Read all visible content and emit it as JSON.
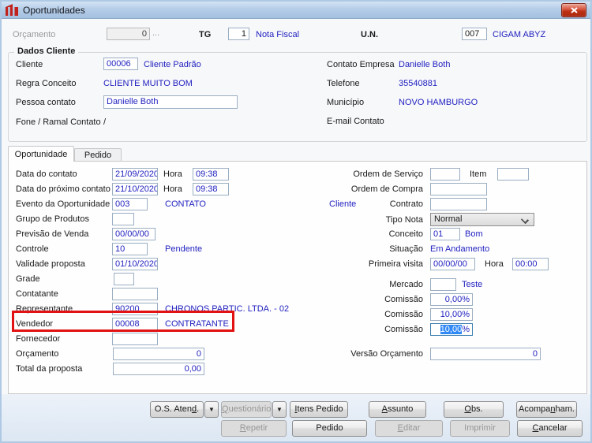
{
  "window": {
    "title": "Oportunidades"
  },
  "icons": {
    "dropdown_arrow": "▼"
  },
  "colors": {
    "value_text": "#2222C0",
    "highlight_box": "#E31212",
    "selection_bg": "#3189F5"
  },
  "header": {
    "orcamento_label": "Orçamento",
    "orcamento_value": "0",
    "ellipsis": "...",
    "tg_label": "TG",
    "tg_value": "1",
    "tg_desc": "Nota Fiscal",
    "un_label": "U.N.",
    "un_value": "007",
    "un_desc": "CIGAM ABYZ"
  },
  "dados_cliente": {
    "title": "Dados Cliente",
    "cliente_label": "Cliente",
    "cliente_value": "00006",
    "cliente_desc": "Cliente Padrão",
    "regra_label": "Regra Conceito",
    "regra_value": "CLIENTE MUITO BOM",
    "pessoa_label": "Pessoa contato",
    "pessoa_value": "Danielle Both",
    "fone_label": "Fone / Ramal Contato",
    "fone_value": "/",
    "contato_empresa_label": "Contato Empresa",
    "contato_empresa_value": "Danielle Both",
    "telefone_label": "Telefone",
    "telefone_value": "35540881",
    "municipio_label": "Município",
    "municipio_value": "NOVO HAMBURGO",
    "email_label": "E-mail Contato",
    "email_value": ""
  },
  "tabs": {
    "oportunidade": "Oportunidade",
    "pedido": "Pedido"
  },
  "left": {
    "rows": [
      {
        "label": "Data do contato",
        "value": "21/09/2020",
        "hora_label": "Hora",
        "hora_value": "09:38"
      },
      {
        "label": "Data do próximo contato",
        "value": "21/10/2020",
        "hora_label": "Hora",
        "hora_value": "09:38"
      },
      {
        "label": "Evento da Oportunidade",
        "value": "003",
        "desc": "CONTATO",
        "extra": "Cliente"
      },
      {
        "label": "Grupo de Produtos",
        "value": ""
      },
      {
        "label": "Previsão de Venda",
        "value": "00/00/00"
      },
      {
        "label": "Controle",
        "value": "10",
        "desc": "Pendente"
      },
      {
        "label": "Validade proposta",
        "value": "01/10/2020"
      },
      {
        "label": "Grade",
        "value": ""
      },
      {
        "label": "Contatante",
        "value": ""
      },
      {
        "label": "Representante",
        "value": "90200",
        "desc": "CHRONOS PARTIC. LTDA. - 02"
      },
      {
        "label": "Vendedor",
        "value": "00008",
        "desc": "CONTRATANTE"
      },
      {
        "label": "Fornecedor",
        "value": ""
      },
      {
        "label": "Orçamento",
        "value": "0"
      },
      {
        "label": "Total da proposta",
        "value": "0,00"
      }
    ]
  },
  "right": {
    "os_label": "Ordem de Serviço",
    "os_value": "",
    "item_label": "Item",
    "item_value": "",
    "oc_label": "Ordem de Compra",
    "oc_value": "",
    "contrato_label": "Contrato",
    "contrato_value": "",
    "tipo_nota_label": "Tipo Nota",
    "tipo_nota_value": "Normal",
    "conceito_label": "Conceito",
    "conceito_value": "01",
    "conceito_desc": "Bom",
    "situacao_label": "Situação",
    "situacao_value": "Em Andamento",
    "visita_label": "Primeira visita",
    "visita_value": "00/00/00",
    "visita_hora_label": "Hora",
    "visita_hora_value": "00:00",
    "mercado_label": "Mercado",
    "mercado_value": "",
    "mercado_desc": "Teste",
    "comissao1_label": "Comissão",
    "comissao1_value": "0,00%",
    "comissao2_label": "Comissão",
    "comissao2_value": "10,00%",
    "comissao3_label": "Comissão",
    "comissao3_selected": "10,00",
    "comissao3_suffix": "%",
    "versao_label": "Versão Orçamento",
    "versao_value": "0"
  },
  "buttons": {
    "row1": [
      {
        "pre": "O.S. Aten",
        "key": "d",
        "post": "."
      },
      {
        "pre": "",
        "key": "Q",
        "post": "uestionário"
      },
      {
        "pre": "",
        "key": "I",
        "post": "tens Pedido"
      },
      {
        "pre": "",
        "key": "A",
        "post": "ssunto"
      },
      {
        "pre": "",
        "key": "O",
        "post": "bs."
      },
      {
        "pre": "Acompa",
        "key": "n",
        "post": "ham."
      }
    ],
    "row2": [
      {
        "pre": "",
        "key": "R",
        "post": "epetir"
      },
      {
        "pre": "Pedido",
        "key": "",
        "post": ""
      },
      {
        "pre": "",
        "key": "E",
        "post": "ditar"
      },
      {
        "pre": "Imprimir",
        "key": "",
        "post": ""
      },
      {
        "pre": "",
        "key": "C",
        "post": "ancelar"
      }
    ]
  }
}
